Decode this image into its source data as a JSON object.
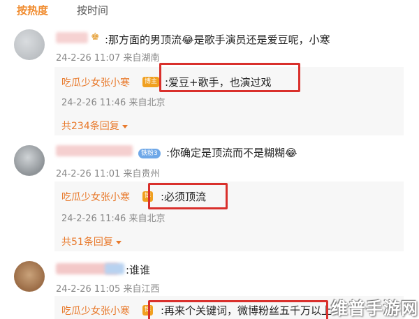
{
  "sort_tabs": {
    "hot": "按热度",
    "time": "按时间"
  },
  "comments": [
    {
      "text": ":那方面的男顶流😂是歌手演员还是爱豆呢，小寒",
      "meta": "24-2-26 11:07 来自湖南",
      "reply": {
        "name": "吃瓜少女张小寒",
        "badge": "博主",
        "text": ":爱豆+歌手，也演过戏",
        "meta": "24-2-26 11:46 来自北京"
      },
      "reply_count": "共234条回复"
    },
    {
      "level_badge": "铁粉3",
      "text": ":你确定是顶流而不是糊糊😂",
      "meta": "24-2-26 11:01 来自贵州",
      "reply": {
        "name": "吃瓜少女张小寒",
        "badge": "博",
        "text": ":必须顶流",
        "meta": "24-2-26 11:46 来自北京"
      },
      "reply_count": "共51条回复"
    },
    {
      "text": ":谁谁",
      "meta": "24-2-26 11:05 来自江西",
      "reply": {
        "name": "吃瓜少女张小寒",
        "badge": "博",
        "text": ":再来个关键词，微博粉丝五千万以上"
      }
    }
  ],
  "watermark": "维普手游网",
  "colors": {
    "accent": "#e8792b",
    "highlight": "#d9302c",
    "reply_bg": "#f7f7f7"
  }
}
